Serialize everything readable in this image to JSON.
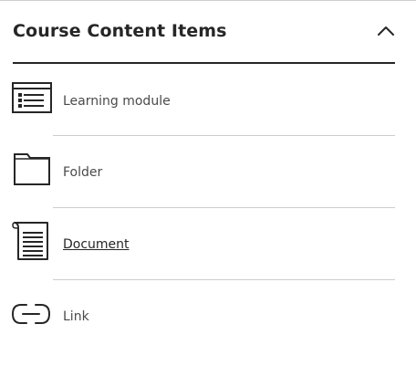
{
  "section": {
    "title": "Course Content Items",
    "toggle_icon": "chevron-up-icon"
  },
  "items": [
    {
      "label": "Learning module",
      "icon": "learning-module-icon",
      "is_link": false
    },
    {
      "label": "Folder",
      "icon": "folder-icon",
      "is_link": false
    },
    {
      "label": "Document",
      "icon": "document-icon",
      "is_link": true
    },
    {
      "label": "Link",
      "icon": "link-icon",
      "is_link": false
    }
  ],
  "colors": {
    "text": "#262626",
    "muted_text": "#4a4a4a",
    "divider": "#cdcdcd"
  }
}
